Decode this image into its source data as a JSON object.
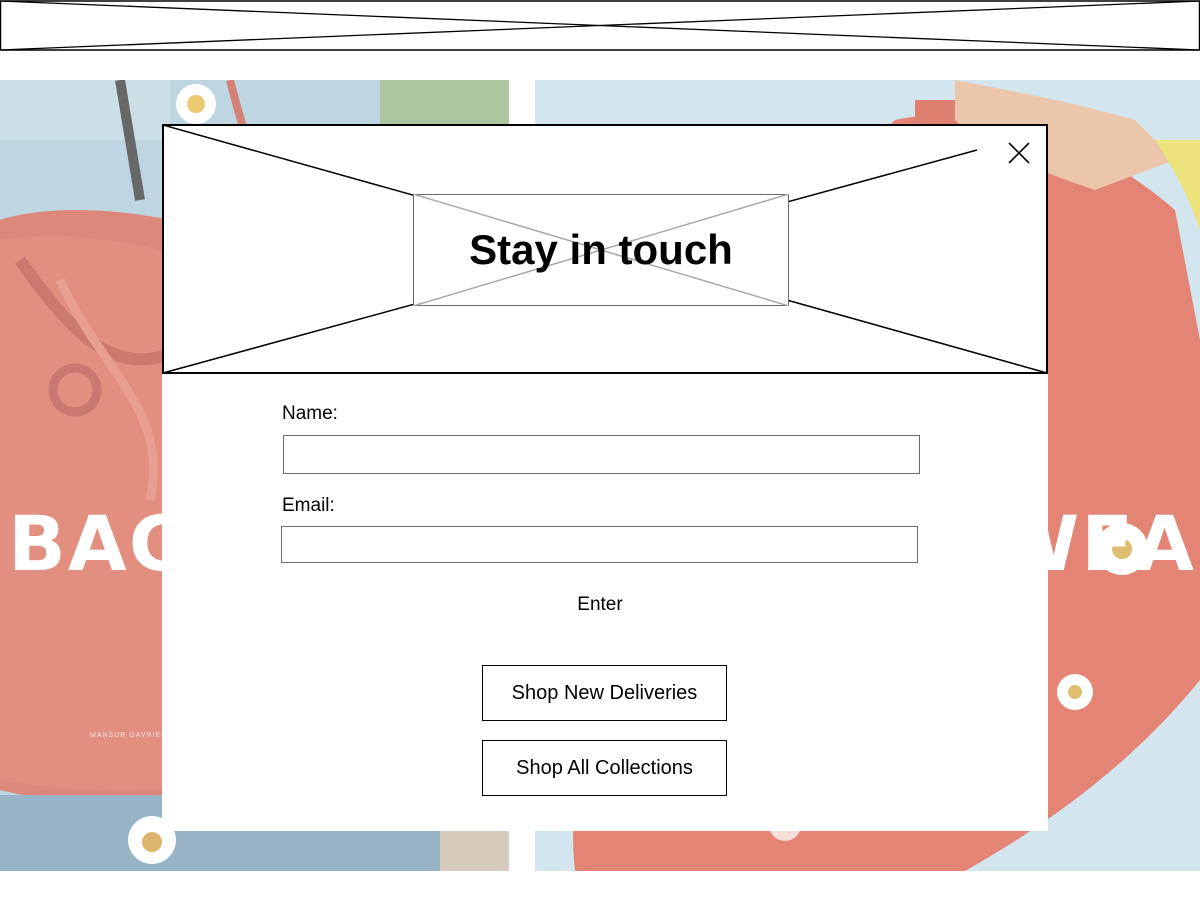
{
  "colors": {
    "background": "#ffffff",
    "placeholder_stroke": "#000000",
    "title_box_stroke": "#999999",
    "hero_sky": "#9fc3d6",
    "hero_bag_red": "#d9503f",
    "hero_text": "#ffffff"
  },
  "header": {
    "placeholder_icon": "image-placeholder-icon"
  },
  "hero": {
    "left_label": "BAG",
    "left_brand": "MANSUR GAVRIEL",
    "right_label": "WEA"
  },
  "modal": {
    "title": "Stay in touch",
    "close_icon": "close-icon",
    "name_label": "Name:",
    "name_value": "",
    "email_label": "Email:",
    "email_value": "",
    "enter_label": "Enter",
    "shop_new_label": "Shop New Deliveries",
    "shop_all_label": "Shop All Collections"
  }
}
